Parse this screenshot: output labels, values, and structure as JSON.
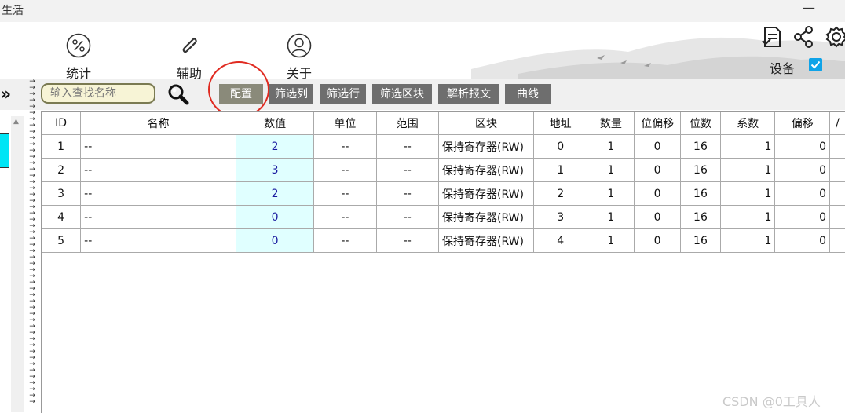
{
  "window": {
    "title": "生活",
    "minimize": "—"
  },
  "ribbon": {
    "buttons": [
      {
        "label": "统计",
        "icon": "percent-icon"
      },
      {
        "label": "辅助",
        "icon": "paperclip-icon"
      },
      {
        "label": "关于",
        "icon": "user-icon"
      }
    ],
    "right_icons": [
      "report-icon",
      "share-icon",
      "gear-icon"
    ],
    "device_label": "设备",
    "device_checked": true
  },
  "toolbar": {
    "search_placeholder": "输入查找名称",
    "buttons": [
      "配置",
      "筛选列",
      "筛选行",
      "筛选区块",
      "解析报文",
      "曲线"
    ],
    "active": "配置"
  },
  "table": {
    "columns": [
      "ID",
      "名称",
      "数值",
      "单位",
      "范围",
      "区块",
      "地址",
      "数量",
      "位偏移",
      "位数",
      "系数",
      "偏移",
      "/"
    ],
    "rows": [
      [
        "1",
        "--",
        "2",
        "--",
        "--",
        "保持寄存器(RW)",
        "0",
        "1",
        "0",
        "16",
        "1",
        "0"
      ],
      [
        "2",
        "--",
        "3",
        "--",
        "--",
        "保持寄存器(RW)",
        "1",
        "1",
        "0",
        "16",
        "1",
        "0"
      ],
      [
        "3",
        "--",
        "2",
        "--",
        "--",
        "保持寄存器(RW)",
        "2",
        "1",
        "0",
        "16",
        "1",
        "0"
      ],
      [
        "4",
        "--",
        "0",
        "--",
        "--",
        "保持寄存器(RW)",
        "3",
        "1",
        "0",
        "16",
        "1",
        "0"
      ],
      [
        "5",
        "--",
        "0",
        "--",
        "--",
        "保持寄存器(RW)",
        "4",
        "1",
        "0",
        "16",
        "1",
        "0"
      ]
    ]
  },
  "watermark": "CSDN @0工具人",
  "colors": {
    "accent": "#0fa3e8",
    "value_cell": "#e0ffff",
    "highlight_circle": "#e02a20",
    "button": "#6e6e6e"
  }
}
